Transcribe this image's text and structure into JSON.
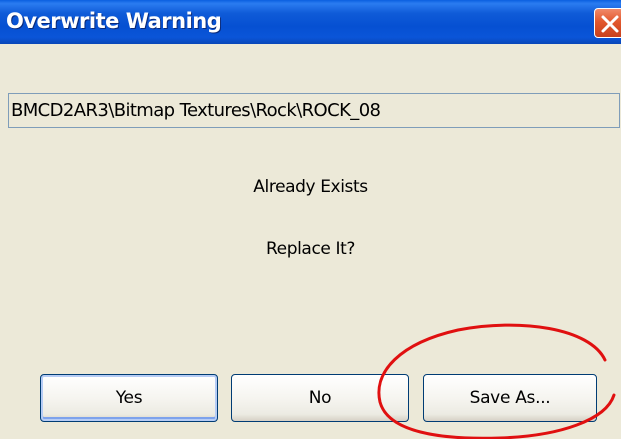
{
  "window": {
    "title": "Overwrite Warning",
    "close_icon": "close-x-icon"
  },
  "dialog": {
    "path": "BMCD2AR3\\Bitmap Textures\\Rock\\ROCK_08",
    "message_line1": "Already Exists",
    "message_line2": "Replace It?"
  },
  "buttons": {
    "yes": "Yes",
    "no": "No",
    "save_as": "Save As..."
  },
  "annotation": {
    "shape": "ellipse",
    "color": "#e01010",
    "highlights": "save_as"
  }
}
